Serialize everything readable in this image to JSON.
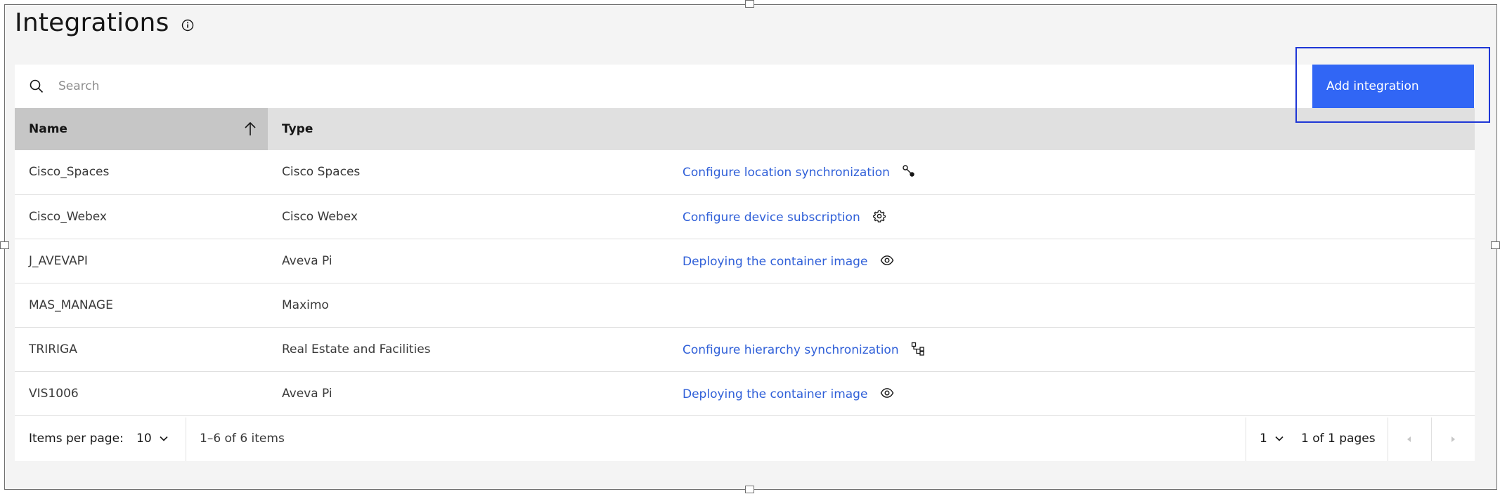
{
  "page": {
    "title": "Integrations",
    "add_button_label": "Add integration"
  },
  "search": {
    "placeholder": "Search",
    "value": ""
  },
  "table": {
    "headers": [
      "Name",
      "Type"
    ],
    "sort": {
      "column": "Name",
      "direction": "ascending"
    },
    "rows": [
      {
        "name": "Cisco_Spaces",
        "type": "Cisco Spaces",
        "action": "Configure location synchronization",
        "icon": "location-sync-icon"
      },
      {
        "name": "Cisco_Webex",
        "type": "Cisco Webex",
        "action": "Configure device subscription",
        "icon": "settings-icon"
      },
      {
        "name": "J_AVEVAPI",
        "type": "Aveva Pi",
        "action": "Deploying the container image",
        "icon": "view-icon"
      },
      {
        "name": "MAS_MANAGE",
        "type": "Maximo",
        "action": "",
        "icon": ""
      },
      {
        "name": "TRIRIGA",
        "type": "Real Estate and Facilities",
        "action": "Configure hierarchy synchronization",
        "icon": "hierarchy-icon"
      },
      {
        "name": "VIS1006",
        "type": "Aveva Pi",
        "action": "Deploying the container image",
        "icon": "view-icon"
      }
    ]
  },
  "pagination": {
    "items_per_page_label": "Items per page:",
    "items_per_page_value": "10",
    "range_text": "1–6 of 6 items",
    "page_value": "1",
    "pages_text": "1 of 1 pages"
  },
  "colors": {
    "primary_button": "#3166f5",
    "link": "#2f5fd8",
    "focus_outline": "#1e36d6",
    "background": "#f4f4f4",
    "header_row": "#e0e0e0",
    "sorted_header": "#c6c6c6"
  }
}
